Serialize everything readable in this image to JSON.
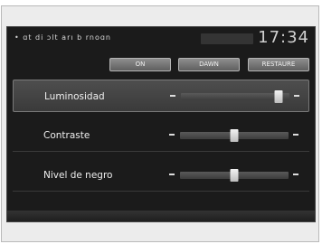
{
  "status": {
    "text": "• ɑt  di ɔlt  arı  b  rnoɑn",
    "clock": "17:34"
  },
  "buttons": [
    {
      "label": "ON"
    },
    {
      "label": "DAWN"
    },
    {
      "label": "RESTAURE"
    }
  ],
  "settings": [
    {
      "label": "Luminosidad",
      "level": 0.9,
      "selected": true
    },
    {
      "label": "Contraste",
      "level": 0.5,
      "selected": false
    },
    {
      "label": "Nivel de negro",
      "level": 0.5,
      "selected": false
    }
  ],
  "colors": {
    "screen_bg": "#1b1b1b",
    "selected_row": "#4a4a4a",
    "thumb": "#e8e8e8"
  }
}
